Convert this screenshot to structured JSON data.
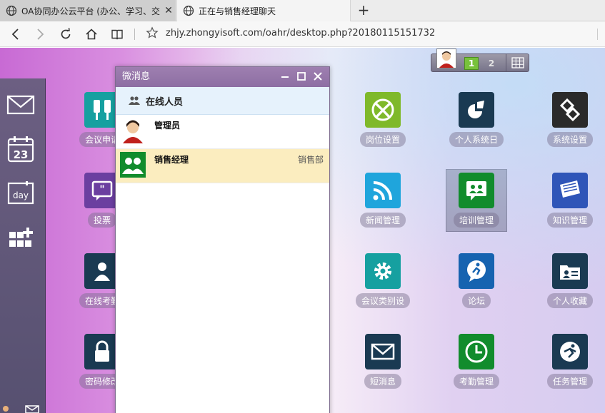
{
  "browser": {
    "tabs": [
      {
        "title": "OA协同办公云平台 (办公、学习、交"
      },
      {
        "title": "正在与销售经理聊天"
      }
    ],
    "url": "zhjy.zhongyisoft.com/oahr/desktop.php?20180115151732"
  },
  "widget": {
    "pages": [
      "1",
      "2"
    ]
  },
  "dock": {
    "items": [
      {
        "icon": "mail-icon"
      },
      {
        "icon": "calendar-icon",
        "text": "23"
      },
      {
        "icon": "day-icon",
        "text": "day"
      },
      {
        "icon": "add-app-icon"
      }
    ]
  },
  "apps": [
    {
      "label": "会议申请",
      "icon": "meeting-icon",
      "color": "#16a0a0"
    },
    {
      "label": "投票",
      "icon": "vote-icon",
      "color": "#6b3fa0"
    },
    {
      "label": "在线考勤",
      "icon": "attendance-icon",
      "color": "#1a3a52"
    },
    {
      "label": "密码修改",
      "icon": "lock-icon",
      "color": "#1a3a52"
    },
    {
      "label": "岗位设置",
      "icon": "xbox-icon",
      "color": "#7fb92a"
    },
    {
      "label": "新闻管理",
      "icon": "rss-icon",
      "color": "#1fa5dc"
    },
    {
      "label": "会议类别设",
      "icon": "gear-icon",
      "color": "#16a0a0"
    },
    {
      "label": "短消息",
      "icon": "envelope-icon",
      "color": "#1a3a52"
    },
    {
      "label": "个人系统日",
      "icon": "chart-icon",
      "color": "#1a3a52"
    },
    {
      "label": "培训管理",
      "icon": "training-icon",
      "color": "#118c2c"
    },
    {
      "label": "论坛",
      "icon": "forum-icon",
      "color": "#1663b0"
    },
    {
      "label": "考勤管理",
      "icon": "clock-icon",
      "color": "#118c2c"
    },
    {
      "label": "系统设置",
      "icon": "settings-icon",
      "color": "#2a2a2a"
    },
    {
      "label": "知识管理",
      "icon": "knowledge-icon",
      "color": "#2f55b8"
    },
    {
      "label": "个人收藏",
      "icon": "favorites-icon",
      "color": "#1a3a52"
    },
    {
      "label": "任务管理",
      "icon": "task-icon",
      "color": "#1a3a52"
    }
  ],
  "chat": {
    "title": "微消息",
    "group": "在线人员",
    "contacts": [
      {
        "name": "管理员",
        "dept": ""
      },
      {
        "name": "销售经理",
        "dept": "销售部"
      }
    ]
  }
}
